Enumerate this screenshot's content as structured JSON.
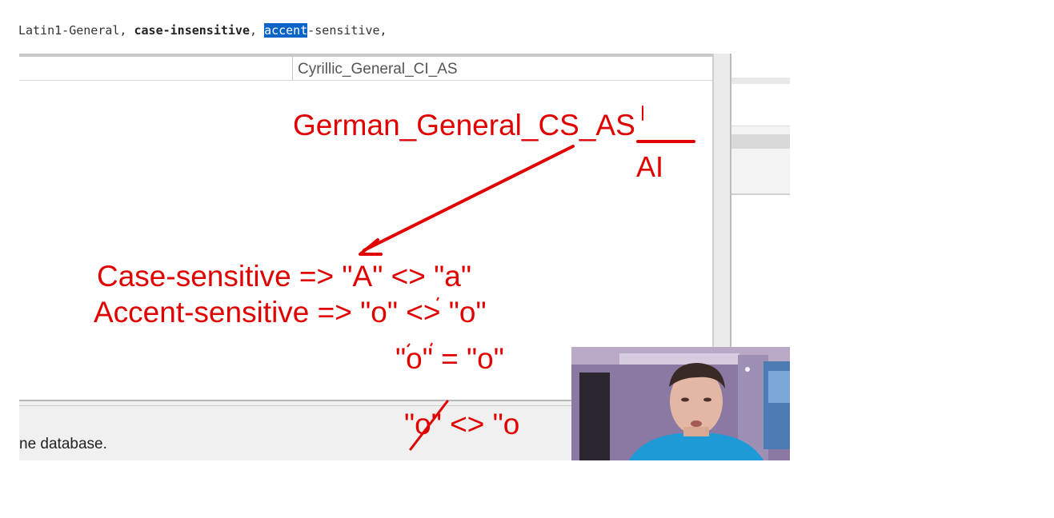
{
  "top_line": {
    "part1": "Latin1-General, ",
    "part2": "case-insensitive",
    "part3": ", ",
    "part4": "accent",
    "part5": "-sensitive,"
  },
  "grid": {
    "column_header": "Cyrillic_General_CI_AS"
  },
  "status": {
    "text": "ne database."
  },
  "annotations": {
    "collation": "German_General_CS_AS",
    "ai": "AI",
    "case_line": "Case-sensitive => \"A\"  <> \"a\"",
    "accent_line": "Accent-sensitive => \"o\" <> \"o\"",
    "equal_line": "\"o\" = \"o\"",
    "struck_line": "\"o\" <> \"o"
  },
  "colors": {
    "annotation": "#e00000",
    "highlight": "#0a64c8"
  }
}
